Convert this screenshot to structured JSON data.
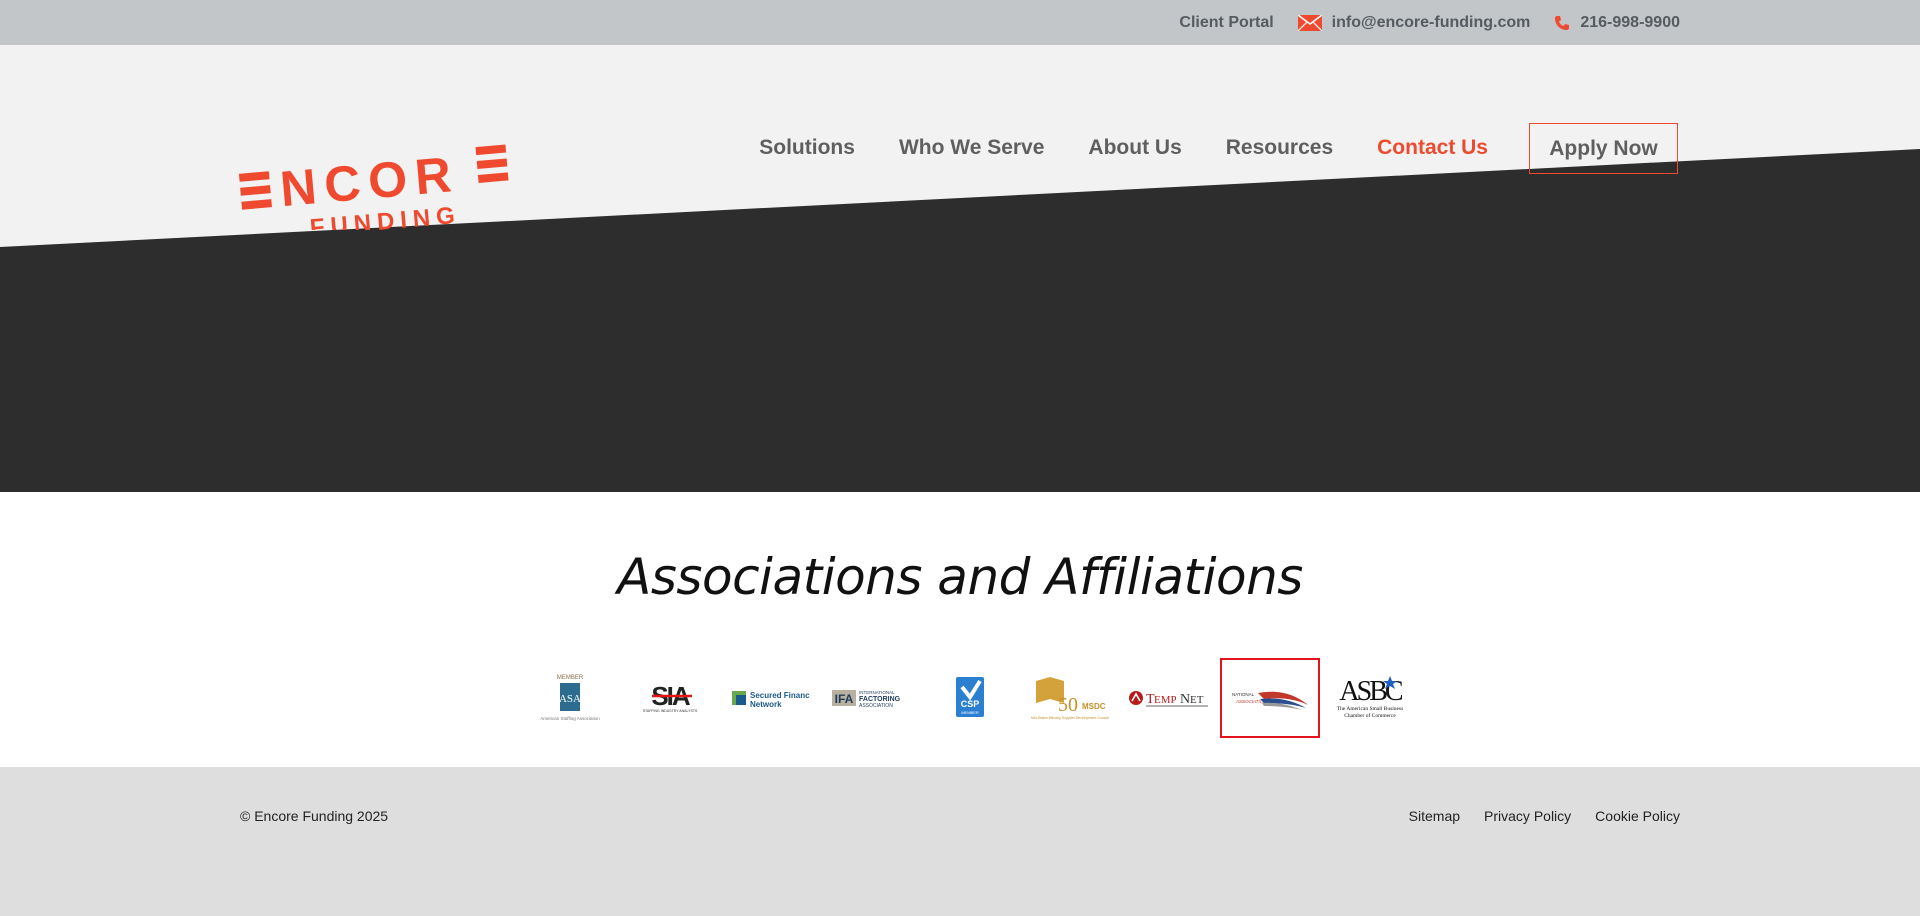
{
  "topbar": {
    "client_portal": "Client Portal",
    "email": "info@encore-funding.com",
    "phone": "216-998-9900",
    "icons": {
      "email": "envelope-icon",
      "phone": "phone-icon"
    }
  },
  "brand": {
    "name_top": "ENCORE",
    "name_bottom": "FUNDING",
    "accent_color": "#ef4a2f",
    "dark_band": "#2d2d2d"
  },
  "nav": {
    "items": [
      {
        "label": "Solutions"
      },
      {
        "label": "Who We Serve"
      },
      {
        "label": "About Us"
      },
      {
        "label": "Resources"
      },
      {
        "label": "Contact Us"
      }
    ],
    "apply_label": "Apply Now"
  },
  "associations": {
    "title": "Associations and Affiliations",
    "logos": [
      {
        "name": "asa",
        "caption": "MEMBER",
        "text": "ASA",
        "subtext": "American Staffing Association"
      },
      {
        "name": "sia",
        "text": "SIA",
        "subtext": "STAFFING INDUSTRY ANALYSTS"
      },
      {
        "name": "sfnet",
        "text": "Secured Finance",
        "subtext": "Network"
      },
      {
        "name": "ifa",
        "text": "IFA",
        "subtext": "INTERNATIONAL FACTORING ASSOCIATION"
      },
      {
        "name": "csp",
        "text": "CSP",
        "subtext": "MEMBER"
      },
      {
        "name": "msdc",
        "text": "50",
        "subtext": "MSDC"
      },
      {
        "name": "tempnet",
        "text": "TEMPNET"
      },
      {
        "name": "national-association",
        "text": "NATIONAL ASSOCIATION"
      },
      {
        "name": "asbc",
        "text": "ASBC",
        "subtext": "The American Small Business Chamber of Commerce"
      }
    ]
  },
  "footer": {
    "copyright": "© Encore Funding 2025",
    "links": [
      {
        "label": "Sitemap"
      },
      {
        "label": "Privacy Policy"
      },
      {
        "label": "Cookie Policy"
      }
    ]
  }
}
